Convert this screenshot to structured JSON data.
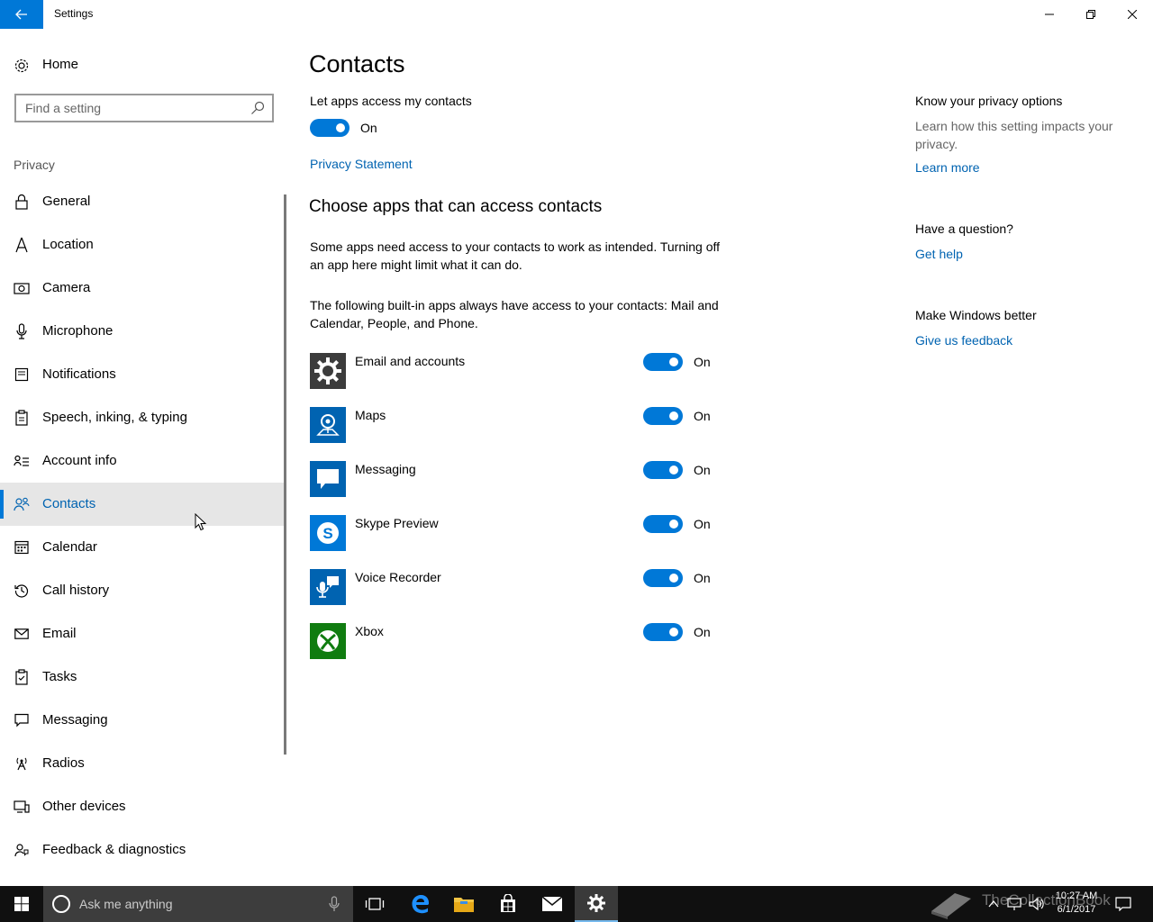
{
  "window": {
    "title": "Settings"
  },
  "sidebar": {
    "home_label": "Home",
    "search_placeholder": "Find a setting",
    "section_label": "Privacy",
    "items": [
      {
        "label": "General",
        "icon": "lock-icon"
      },
      {
        "label": "Location",
        "icon": "location-icon"
      },
      {
        "label": "Camera",
        "icon": "camera-icon"
      },
      {
        "label": "Microphone",
        "icon": "microphone-icon"
      },
      {
        "label": "Notifications",
        "icon": "notifications-icon"
      },
      {
        "label": "Speech, inking, & typing",
        "icon": "clipboard-icon"
      },
      {
        "label": "Account info",
        "icon": "account-info-icon"
      },
      {
        "label": "Contacts",
        "icon": "contacts-icon",
        "selected": true
      },
      {
        "label": "Calendar",
        "icon": "calendar-icon"
      },
      {
        "label": "Call history",
        "icon": "history-icon"
      },
      {
        "label": "Email",
        "icon": "email-icon"
      },
      {
        "label": "Tasks",
        "icon": "tasks-icon"
      },
      {
        "label": "Messaging",
        "icon": "messaging-icon"
      },
      {
        "label": "Radios",
        "icon": "radios-icon"
      },
      {
        "label": "Other devices",
        "icon": "devices-icon"
      },
      {
        "label": "Feedback & diagnostics",
        "icon": "feedback-icon"
      }
    ]
  },
  "main": {
    "title": "Contacts",
    "access_label": "Let apps access my contacts",
    "access_state": "On",
    "privacy_link": "Privacy Statement",
    "choose_title": "Choose apps that can access contacts",
    "para1": "Some apps need access to your contacts to work as intended. Turning off an app here might limit what it can do.",
    "para2": "The following built-in apps always have access to your contacts: Mail and Calendar, People, and Phone.",
    "apps": [
      {
        "name": "Email and accounts",
        "state": "On",
        "icon": "gear-icon",
        "color": "#3c3c3c"
      },
      {
        "name": "Maps",
        "state": "On",
        "icon": "maps-icon",
        "color": "#0063b1"
      },
      {
        "name": "Messaging",
        "state": "On",
        "icon": "messaging-icon",
        "color": "#0063b1"
      },
      {
        "name": "Skype Preview",
        "state": "On",
        "icon": "skype-icon",
        "color": "#0078d7"
      },
      {
        "name": "Voice Recorder",
        "state": "On",
        "icon": "voice-recorder-icon",
        "color": "#0063b1"
      },
      {
        "name": "Xbox",
        "state": "On",
        "icon": "xbox-icon",
        "color": "#107c10"
      }
    ]
  },
  "right": {
    "privacy_head": "Know your privacy options",
    "privacy_text": "Learn how this setting impacts your privacy.",
    "learn_more": "Learn more",
    "question_head": "Have a question?",
    "get_help": "Get help",
    "better_head": "Make Windows better",
    "feedback_link": "Give us feedback"
  },
  "taskbar": {
    "search_text": "Ask me anything",
    "time": "10:27 AM",
    "date": "6/1/2017",
    "watermark": "TheCollectionBook"
  },
  "colors": {
    "accent": "#0078d7",
    "link": "#0063b1"
  }
}
